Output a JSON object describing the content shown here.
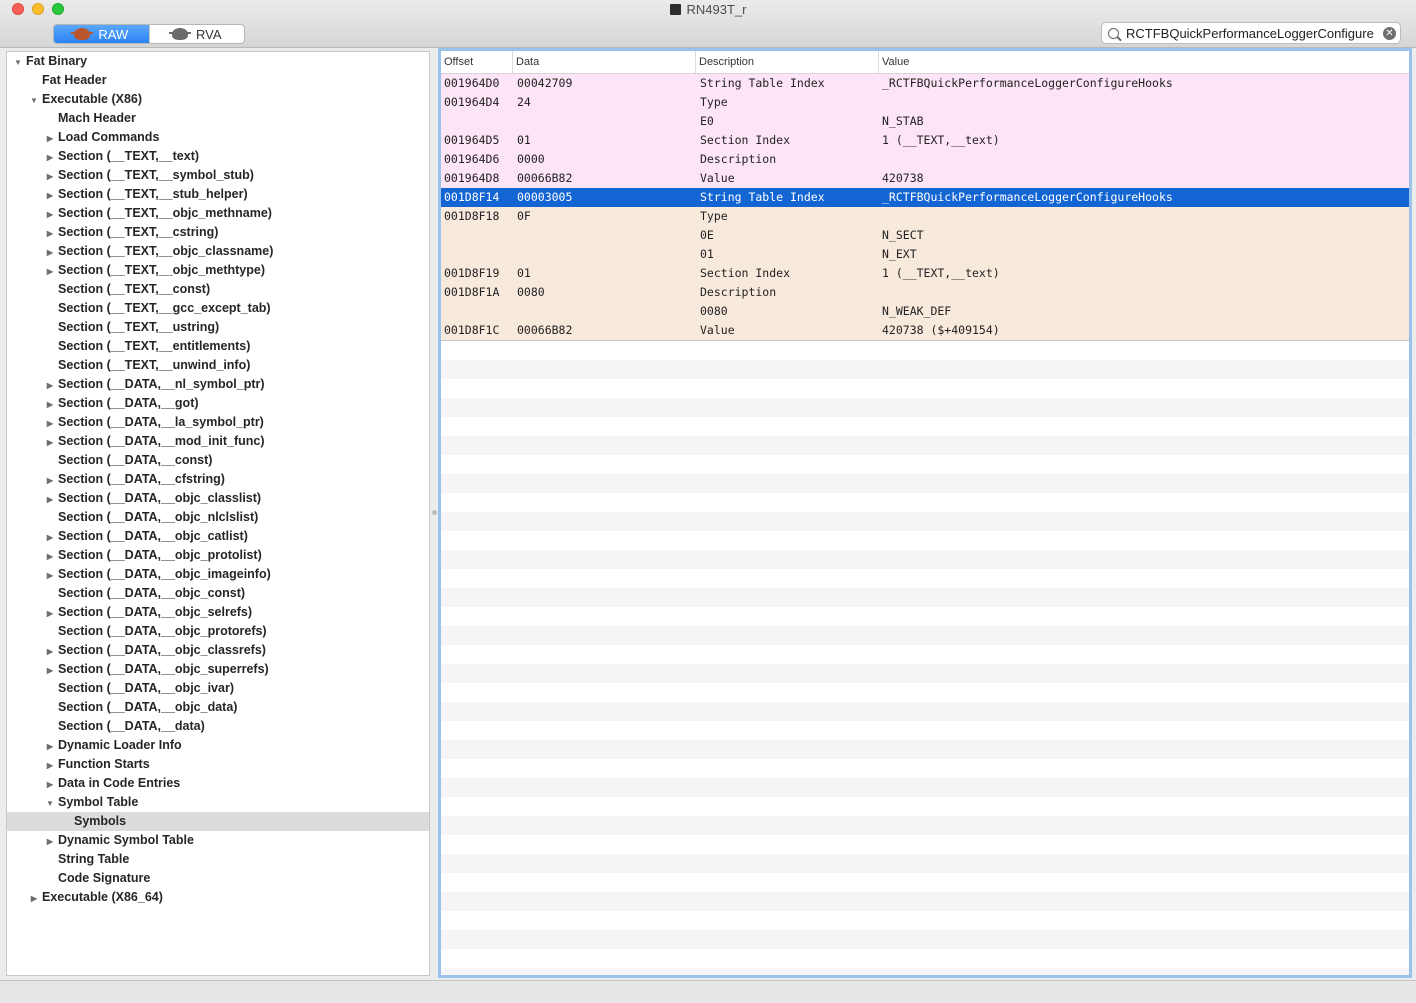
{
  "window": {
    "title": "RN493T_r"
  },
  "toolbar": {
    "mode_buttons": [
      {
        "label": "RAW",
        "icon": "bug-icon",
        "active": true
      },
      {
        "label": "RVA",
        "icon": "bug-icon",
        "active": false
      }
    ],
    "search": {
      "value": "RCTFBQuickPerformanceLoggerConfigure",
      "placeholder": ""
    }
  },
  "sidebar": {
    "items": [
      {
        "label": "Fat Binary",
        "level": 0,
        "disclosure": "expanded"
      },
      {
        "label": "Fat Header",
        "level": 1,
        "disclosure": "none"
      },
      {
        "label": "Executable  (X86)",
        "level": 1,
        "disclosure": "expanded"
      },
      {
        "label": "Mach Header",
        "level": 2,
        "disclosure": "none"
      },
      {
        "label": "Load Commands",
        "level": 2,
        "disclosure": "collapsed"
      },
      {
        "label": "Section (__TEXT,__text)",
        "level": 2,
        "disclosure": "collapsed"
      },
      {
        "label": "Section (__TEXT,__symbol_stub)",
        "level": 2,
        "disclosure": "collapsed"
      },
      {
        "label": "Section (__TEXT,__stub_helper)",
        "level": 2,
        "disclosure": "collapsed"
      },
      {
        "label": "Section (__TEXT,__objc_methname)",
        "level": 2,
        "disclosure": "collapsed"
      },
      {
        "label": "Section (__TEXT,__cstring)",
        "level": 2,
        "disclosure": "collapsed"
      },
      {
        "label": "Section (__TEXT,__objc_classname)",
        "level": 2,
        "disclosure": "collapsed"
      },
      {
        "label": "Section (__TEXT,__objc_methtype)",
        "level": 2,
        "disclosure": "collapsed"
      },
      {
        "label": "Section (__TEXT,__const)",
        "level": 2,
        "disclosure": "none"
      },
      {
        "label": "Section (__TEXT,__gcc_except_tab)",
        "level": 2,
        "disclosure": "none"
      },
      {
        "label": "Section (__TEXT,__ustring)",
        "level": 2,
        "disclosure": "none"
      },
      {
        "label": "Section (__TEXT,__entitlements)",
        "level": 2,
        "disclosure": "none"
      },
      {
        "label": "Section (__TEXT,__unwind_info)",
        "level": 2,
        "disclosure": "none"
      },
      {
        "label": "Section (__DATA,__nl_symbol_ptr)",
        "level": 2,
        "disclosure": "collapsed"
      },
      {
        "label": "Section (__DATA,__got)",
        "level": 2,
        "disclosure": "collapsed"
      },
      {
        "label": "Section (__DATA,__la_symbol_ptr)",
        "level": 2,
        "disclosure": "collapsed"
      },
      {
        "label": "Section (__DATA,__mod_init_func)",
        "level": 2,
        "disclosure": "collapsed"
      },
      {
        "label": "Section (__DATA,__const)",
        "level": 2,
        "disclosure": "none"
      },
      {
        "label": "Section (__DATA,__cfstring)",
        "level": 2,
        "disclosure": "collapsed"
      },
      {
        "label": "Section (__DATA,__objc_classlist)",
        "level": 2,
        "disclosure": "collapsed"
      },
      {
        "label": "Section (__DATA,__objc_nlclslist)",
        "level": 2,
        "disclosure": "none"
      },
      {
        "label": "Section (__DATA,__objc_catlist)",
        "level": 2,
        "disclosure": "collapsed"
      },
      {
        "label": "Section (__DATA,__objc_protolist)",
        "level": 2,
        "disclosure": "collapsed"
      },
      {
        "label": "Section (__DATA,__objc_imageinfo)",
        "level": 2,
        "disclosure": "collapsed"
      },
      {
        "label": "Section (__DATA,__objc_const)",
        "level": 2,
        "disclosure": "none"
      },
      {
        "label": "Section (__DATA,__objc_selrefs)",
        "level": 2,
        "disclosure": "collapsed"
      },
      {
        "label": "Section (__DATA,__objc_protorefs)",
        "level": 2,
        "disclosure": "none"
      },
      {
        "label": "Section (__DATA,__objc_classrefs)",
        "level": 2,
        "disclosure": "collapsed"
      },
      {
        "label": "Section (__DATA,__objc_superrefs)",
        "level": 2,
        "disclosure": "collapsed"
      },
      {
        "label": "Section (__DATA,__objc_ivar)",
        "level": 2,
        "disclosure": "none"
      },
      {
        "label": "Section (__DATA,__objc_data)",
        "level": 2,
        "disclosure": "none"
      },
      {
        "label": "Section (__DATA,__data)",
        "level": 2,
        "disclosure": "none"
      },
      {
        "label": "Dynamic Loader Info",
        "level": 2,
        "disclosure": "collapsed"
      },
      {
        "label": "Function Starts",
        "level": 2,
        "disclosure": "collapsed"
      },
      {
        "label": "Data in Code Entries",
        "level": 2,
        "disclosure": "collapsed"
      },
      {
        "label": "Symbol Table",
        "level": 2,
        "disclosure": "expanded"
      },
      {
        "label": "Symbols",
        "level": 3,
        "disclosure": "none",
        "selected": true
      },
      {
        "label": "Dynamic Symbol Table",
        "level": 2,
        "disclosure": "collapsed"
      },
      {
        "label": "String Table",
        "level": 2,
        "disclosure": "none"
      },
      {
        "label": "Code Signature",
        "level": 2,
        "disclosure": "none"
      },
      {
        "label": "Executable  (X86_64)",
        "level": 1,
        "disclosure": "collapsed"
      }
    ]
  },
  "table": {
    "columns": [
      "Offset",
      "Data",
      "Description",
      "Value"
    ],
    "rows": [
      {
        "offset": "001964D0",
        "data": "00042709",
        "description": "String Table Index",
        "value": "_RCTFBQuickPerformanceLoggerConfigureHooks",
        "group": 1
      },
      {
        "offset": "001964D4",
        "data": "24",
        "description": "Type",
        "value": "",
        "group": 1
      },
      {
        "offset": "",
        "data": "",
        "description": "E0",
        "value": "N_STAB",
        "group": 1
      },
      {
        "offset": "001964D5",
        "data": "01",
        "description": "Section Index",
        "value": "1 (__TEXT,__text)",
        "group": 1
      },
      {
        "offset": "001964D6",
        "data": "0000",
        "description": "Description",
        "value": "",
        "group": 1
      },
      {
        "offset": "001964D8",
        "data": "00066B82",
        "description": "Value",
        "value": "420738",
        "group": 1
      },
      {
        "offset": "001D8F14",
        "data": "00003005",
        "description": "String Table Index",
        "value": "_RCTFBQuickPerformanceLoggerConfigureHooks",
        "group": 2,
        "selected": true
      },
      {
        "offset": "001D8F18",
        "data": "0F",
        "description": "Type",
        "value": "",
        "group": 2
      },
      {
        "offset": "",
        "data": "",
        "description": "0E",
        "value": "N_SECT",
        "group": 2
      },
      {
        "offset": "",
        "data": "",
        "description": "01",
        "value": "N_EXT",
        "group": 2
      },
      {
        "offset": "001D8F19",
        "data": "01",
        "description": "Section Index",
        "value": "1 (__TEXT,__text)",
        "group": 2
      },
      {
        "offset": "001D8F1A",
        "data": "0080",
        "description": "Description",
        "value": "",
        "group": 2
      },
      {
        "offset": "",
        "data": "",
        "description": "0080",
        "value": "N_WEAK_DEF",
        "group": 2
      },
      {
        "offset": "001D8F1C",
        "data": "00066B82",
        "description": "Value",
        "value": "420738 ($+409154)",
        "group": 2
      }
    ]
  },
  "colors": {
    "accent": "#1465d4",
    "group1": "#fde4f6",
    "group2": "#f7e9dc"
  }
}
